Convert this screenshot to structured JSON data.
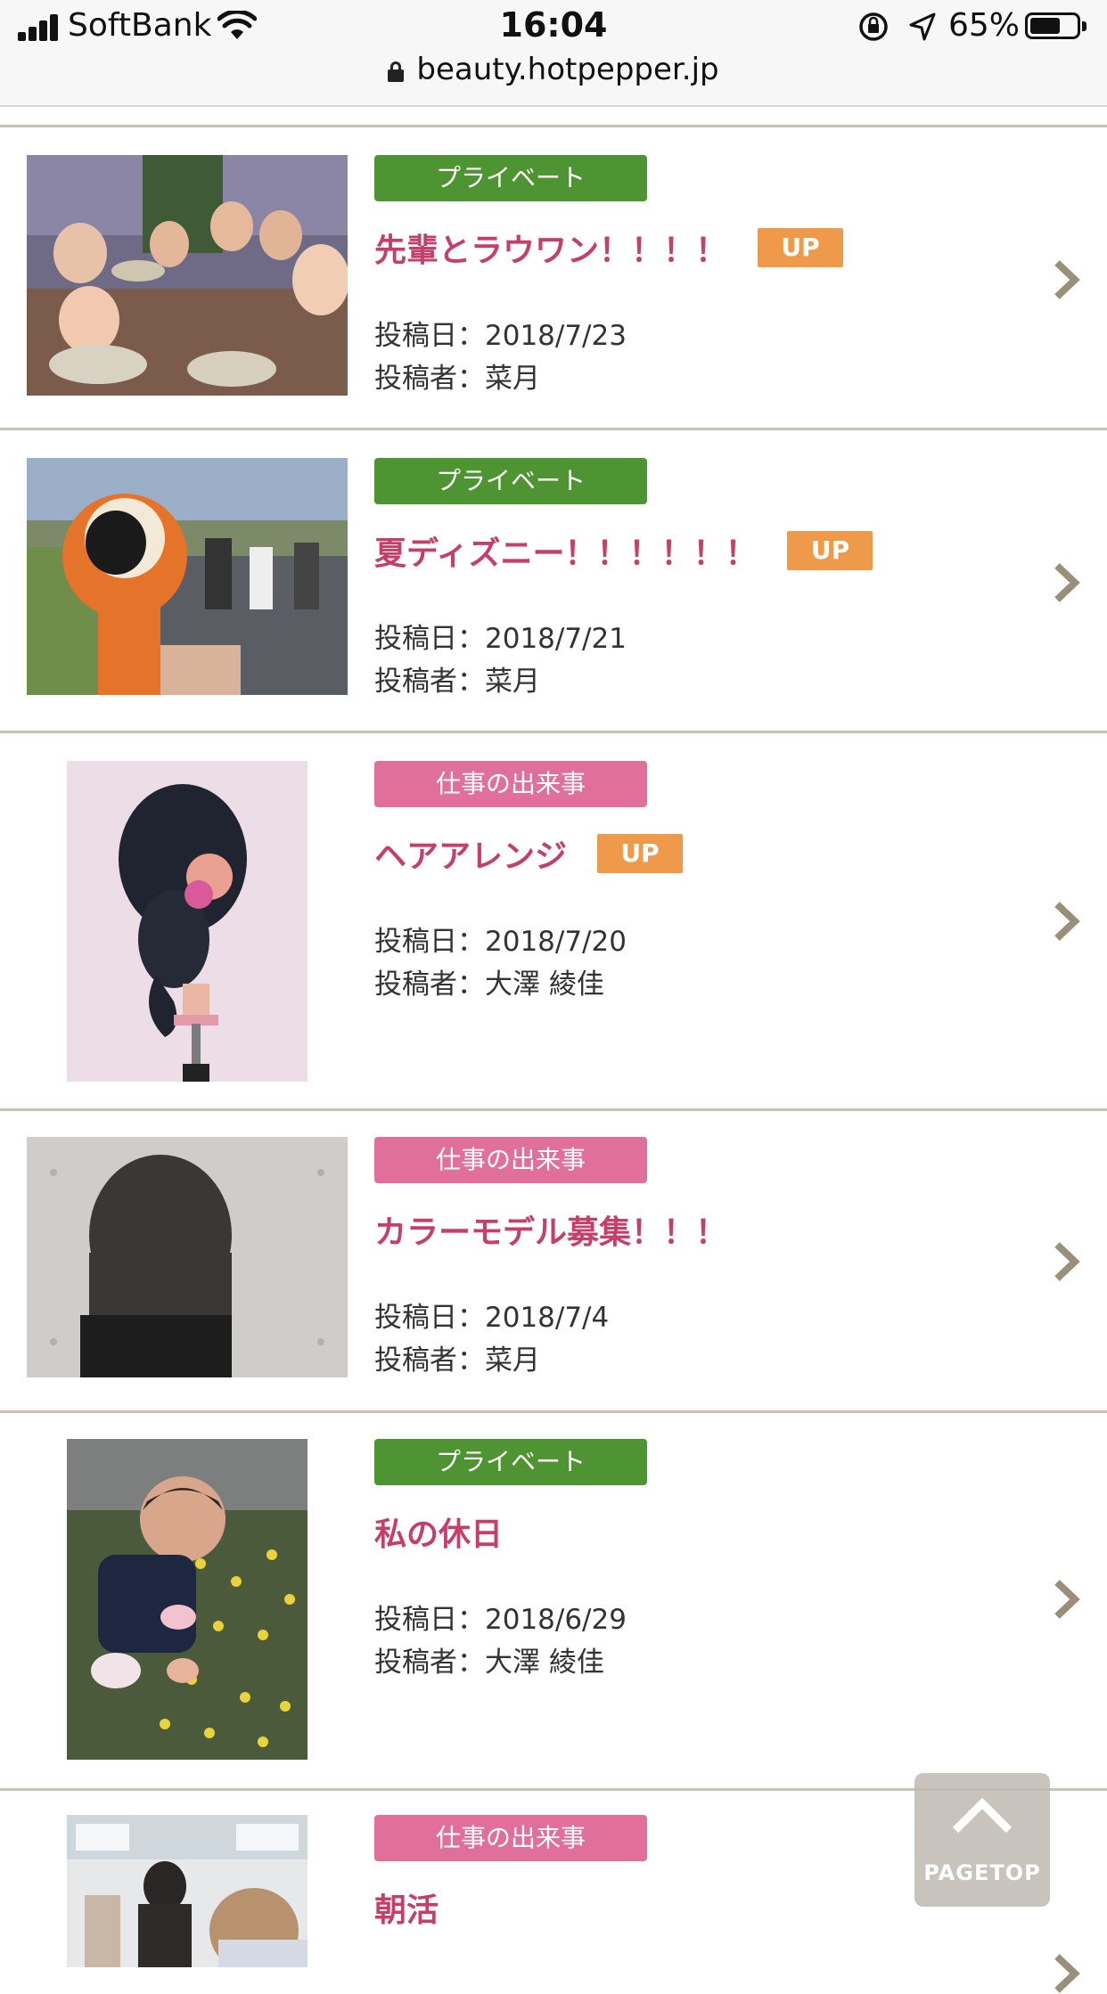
{
  "status_bar": {
    "carrier": "SoftBank",
    "time": "16:04",
    "battery_percent": "65%",
    "battery_level": 0.65,
    "url": "beauty.hotpepper.jp"
  },
  "posts": [
    {
      "category": "プライベート",
      "title": "先輩とラウワン！！！！",
      "badge": "UP",
      "date": "投稿日：2018/7/23",
      "author": "投稿者：菜月"
    },
    {
      "category": "プライベート",
      "title": "夏ディズニー！！！！！！",
      "badge": "UP",
      "date": "投稿日：2018/7/21",
      "author": "投稿者：菜月"
    },
    {
      "category": "仕事の出来事",
      "title": "ヘアアレンジ",
      "badge": "UP",
      "date": "投稿日：2018/7/20",
      "author": "投稿者：大澤 綾佳"
    },
    {
      "category": "仕事の出来事",
      "title": "カラーモデル募集！！！",
      "date": "投稿日：2018/7/4",
      "author": "投稿者：菜月"
    },
    {
      "category": "プライベート",
      "title": "私の休日",
      "date": "投稿日：2018/6/29",
      "author": "投稿者：大澤 綾佳"
    },
    {
      "category": "仕事の出来事",
      "title": "朝活"
    }
  ],
  "pagetop": {
    "label": "PAGETOP"
  },
  "colors": {
    "private_tag": "#4f9432",
    "work_tag": "#e0709a",
    "title": "#c4406a",
    "up_badge": "#ee9a4a",
    "divider": "#c8c2b8"
  }
}
